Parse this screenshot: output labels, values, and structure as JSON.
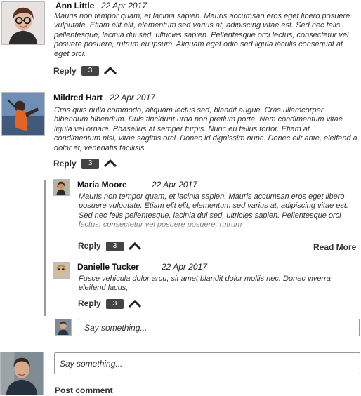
{
  "comments": [
    {
      "author": "Ann Little",
      "date": "22 Apr 2017",
      "body": "Mauris non tempor quam, et lacinia sapien. Mauris accumsan eros eget libero posuere vulputate. Etiam elit elit, elementum sed varius at, adipiscing vitae est. Sed nec felis pellentesque, lacinia dui sed, ultricies sapien. Pellentesque orci lectus, consectetur vel posuere posuere, rutrum eu ipsum. Aliquam eget odio sed ligula iaculis consequat at eget orci.",
      "reply_label": "Reply",
      "reply_count": "3"
    },
    {
      "author": "Mildred Hart",
      "date": "22 Apr 2017",
      "body": "Cras quis nulla commodo, aliquam lectus sed, blandit augue. Cras ullamcorper bibendum bibendum. Duis tincidunt urna non pretium porta. Nam condimentum vitae ligula vel ornare. Phasellus at semper turpis. Nunc eu tellus tortor. Etiam at condimentum nisl, vitae sagittis orci. Donec id dignissim nunc. Donec elit ante, eleifend a dolor et, venenatis facilisis.",
      "reply_label": "Reply",
      "reply_count": "3"
    }
  ],
  "replies": [
    {
      "author": "Maria Moore",
      "date": "22 Apr 2017",
      "body": "Mauris non tempor quam, et lacinia sapien. Mauris accumsan eros eget libero posuere vulputate. Etiam elit elit, elementum sed varius at, adipiscing vitae est. Sed nec felis pellentesque, lacinia dui sed, ultricies sapien. Pellentesque orci lectus, consectetur vel posuere posuere, rutrum",
      "reply_label": "Reply",
      "reply_count": "3",
      "read_more_label": "Read More"
    },
    {
      "author": "Danielle Tucker",
      "date": "22 Apr 2017",
      "body": "Fusce vehicula dolor arcu, sit amet blandit dolor mollis nec. Donec viverra eleifend lacus,.",
      "reply_label": "Reply",
      "reply_count": "3"
    }
  ],
  "thread_input": {
    "placeholder": "Say something..."
  },
  "main_input": {
    "placeholder": "Say something..."
  },
  "post_comment_label": "Post comment",
  "icons": {
    "collapse": "chevron-up-icon"
  }
}
